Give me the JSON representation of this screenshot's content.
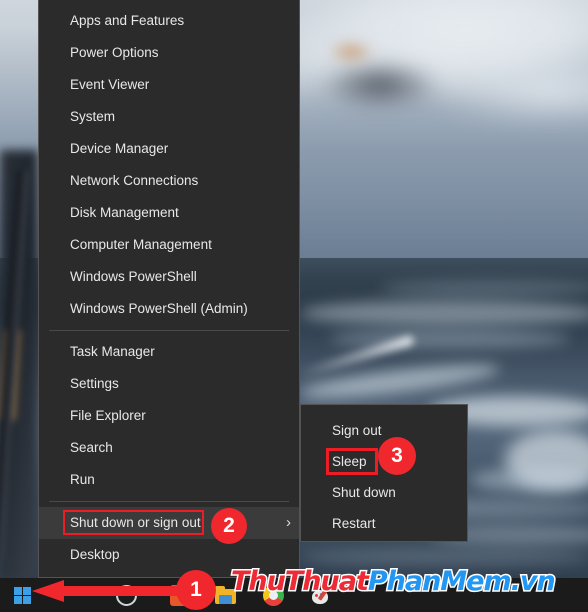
{
  "os": "Windows 10",
  "wallpaper": {
    "description": "blurred seascape with waves and overcast sky",
    "sky_color": "#9fadbc",
    "sea_color": "#3b4b5c"
  },
  "win_x_menu": {
    "name": "Win+X Quick Link menu",
    "background": "#2b2b2b",
    "items": [
      {
        "label": "Apps and Features",
        "divider_after": false,
        "highlighted": false,
        "has_submenu": false
      },
      {
        "label": "Power Options",
        "divider_after": false,
        "highlighted": false,
        "has_submenu": false
      },
      {
        "label": "Event Viewer",
        "divider_after": false,
        "highlighted": false,
        "has_submenu": false
      },
      {
        "label": "System",
        "divider_after": false,
        "highlighted": false,
        "has_submenu": false
      },
      {
        "label": "Device Manager",
        "divider_after": false,
        "highlighted": false,
        "has_submenu": false
      },
      {
        "label": "Network Connections",
        "divider_after": false,
        "highlighted": false,
        "has_submenu": false
      },
      {
        "label": "Disk Management",
        "divider_after": false,
        "highlighted": false,
        "has_submenu": false
      },
      {
        "label": "Computer Management",
        "divider_after": false,
        "highlighted": false,
        "has_submenu": false
      },
      {
        "label": "Windows PowerShell",
        "divider_after": false,
        "highlighted": false,
        "has_submenu": false
      },
      {
        "label": "Windows PowerShell (Admin)",
        "divider_after": true,
        "highlighted": false,
        "has_submenu": false
      },
      {
        "label": "Task Manager",
        "divider_after": false,
        "highlighted": false,
        "has_submenu": false
      },
      {
        "label": "Settings",
        "divider_after": false,
        "highlighted": false,
        "has_submenu": false
      },
      {
        "label": "File Explorer",
        "divider_after": false,
        "highlighted": false,
        "has_submenu": false
      },
      {
        "label": "Search",
        "divider_after": false,
        "highlighted": false,
        "has_submenu": false
      },
      {
        "label": "Run",
        "divider_after": true,
        "highlighted": false,
        "has_submenu": false
      },
      {
        "label": "Shut down or sign out",
        "divider_after": false,
        "highlighted": true,
        "has_submenu": true
      },
      {
        "label": "Desktop",
        "divider_after": false,
        "highlighted": false,
        "has_submenu": false
      }
    ],
    "submenu_chevron": "›"
  },
  "power_submenu": {
    "name": "Shut down or sign out submenu",
    "items": [
      {
        "label": "Sign out",
        "highlighted": false
      },
      {
        "label": "Sleep",
        "highlighted": true
      },
      {
        "label": "Shut down",
        "highlighted": false
      },
      {
        "label": "Restart",
        "highlighted": false
      }
    ]
  },
  "taskbar": {
    "start_button_label": "Start",
    "icons": [
      {
        "name": "cortana-search-icon",
        "label": "Search"
      },
      {
        "name": "unikey-icon",
        "label": "UniKey"
      },
      {
        "name": "file-explorer-icon",
        "label": "File Explorer"
      },
      {
        "name": "chrome-icon",
        "label": "Google Chrome"
      },
      {
        "name": "paint-icon",
        "label": "Paint"
      }
    ]
  },
  "annotations": {
    "accent_color": "#ee1c25",
    "badge_color": "#f0282d",
    "steps": [
      {
        "number": "1",
        "target": "start-button"
      },
      {
        "number": "2",
        "target": "shut-down-or-sign-out"
      },
      {
        "number": "3",
        "target": "sleep"
      }
    ],
    "arrow_label": "arrow pointing to Start button"
  },
  "watermark": {
    "part1": "ThuThuat",
    "part2": "PhanMem",
    "part3": ".vn",
    "color1": "#ee2a35",
    "color2": "#2196f3"
  }
}
